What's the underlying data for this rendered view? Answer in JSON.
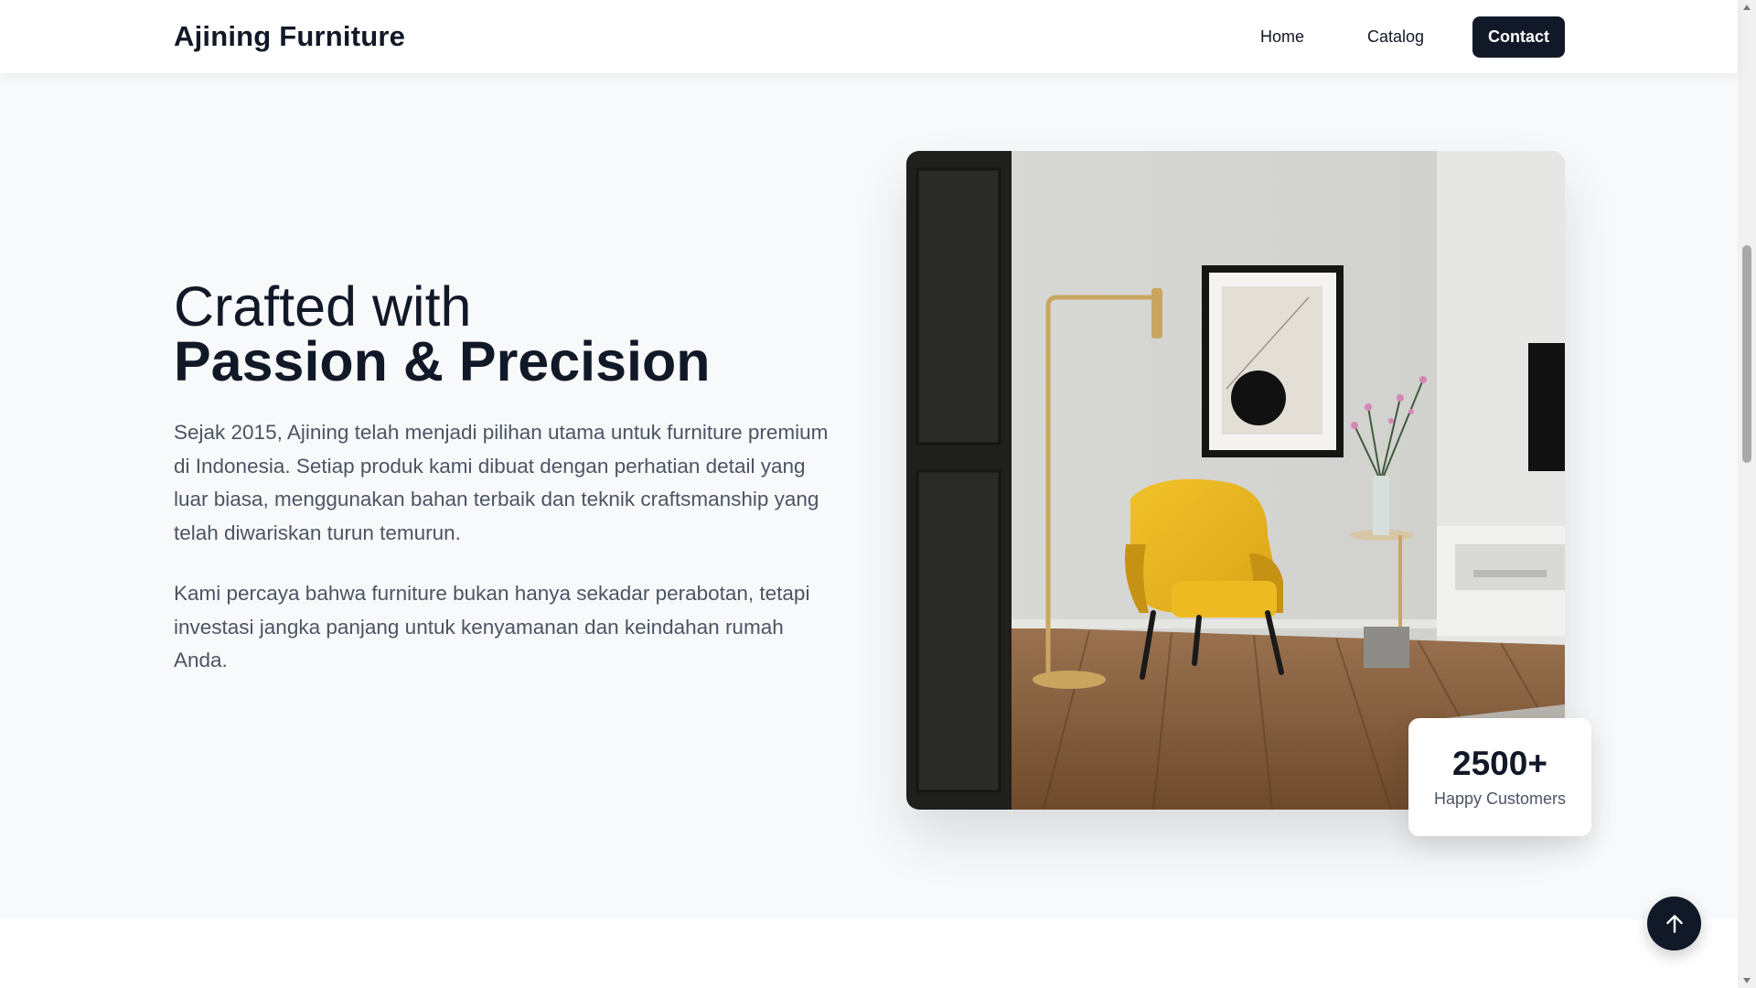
{
  "header": {
    "brand": "Ajining Furniture",
    "nav": {
      "home": "Home",
      "catalog": "Catalog",
      "contact": "Contact"
    }
  },
  "hero": {
    "title_line1": "Crafted with",
    "title_line2": "Passion & Precision",
    "paragraph1": "Sejak 2015, Ajining telah menjadi pilihan utama untuk furniture premium di Indonesia. Setiap produk kami dibuat dengan perhatian detail yang luar biasa, menggunakan bahan terbaik dan teknik craftsmanship yang telah diwariskan turun temurun.",
    "paragraph2": "Kami percaya bahwa furniture bukan hanya sekadar perabotan, tetapi investasi jangka panjang untuk kenyamanan dan keindahan rumah Anda."
  },
  "stat": {
    "value": "2500+",
    "label": "Happy Customers"
  },
  "icons": {
    "back_to_top": "arrow-up-icon",
    "scroll_up": "triangle-up-icon",
    "scroll_down": "triangle-down-icon"
  },
  "colors": {
    "primary": "#111827",
    "text_muted": "#4b5563",
    "background": "#f8f9fb",
    "accent_chair": "#e8b81e"
  }
}
